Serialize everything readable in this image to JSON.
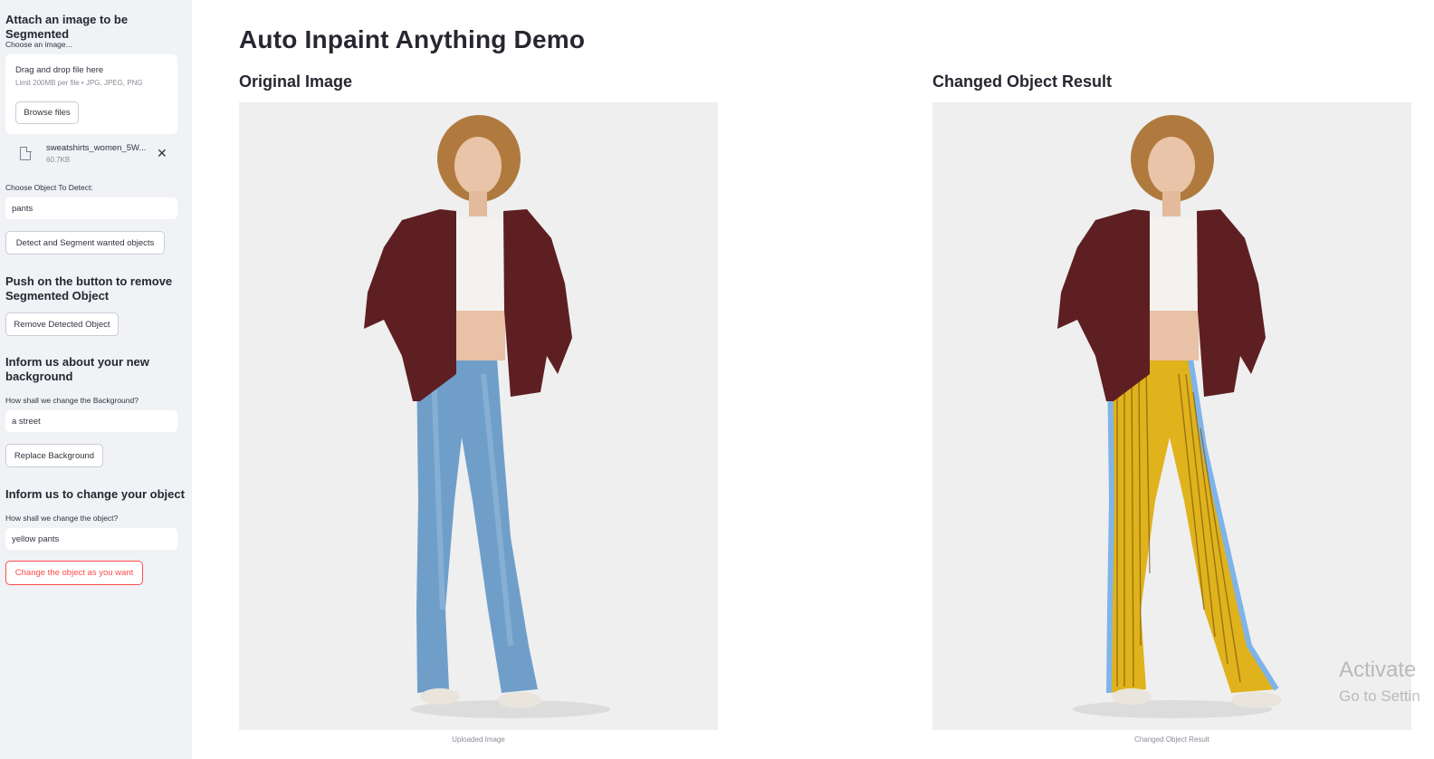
{
  "sidebar": {
    "upload_heading": "Attach an image to be Segmented",
    "choose_image_label": "Choose an image...",
    "drag_drop_text": "Drag and drop file here",
    "limit_text": "Limit 200MB per file • JPG, JPEG, PNG",
    "browse_label": "Browse files",
    "file_name": "sweatshirts_women_5W...",
    "file_size": "60.7KB",
    "object_label": "Choose Object To Detect:",
    "object_value": "pants",
    "detect_button": "Detect and Segment wanted objects",
    "remove_heading": "Push on the button to remove Segmented Object",
    "remove_button": "Remove Detected Object",
    "background_heading": "Inform us about your new background",
    "background_label": "How shall we change the Background?",
    "background_value": "a street",
    "replace_button": "Replace Background",
    "change_heading": "Inform us to change your object",
    "change_label": "How shall we change the object?",
    "change_value": "yellow pants",
    "change_button": "Change the object as you want"
  },
  "main": {
    "title": "Auto Inpaint Anything Demo",
    "original_heading": "Original Image",
    "original_caption": "Uploaded Image",
    "result_heading": "Changed Object Result",
    "result_caption": "Changed Object Result"
  },
  "watermark": {
    "line1": "Activate",
    "line2": "Go to Settin"
  },
  "colors": {
    "sidebar_bg": "#f0f2f6",
    "accent_red": "#ff4b4b",
    "jacket": "#5e1f22",
    "jeans": "#6f9fc9",
    "yellow_pants": "#e0b21c"
  }
}
